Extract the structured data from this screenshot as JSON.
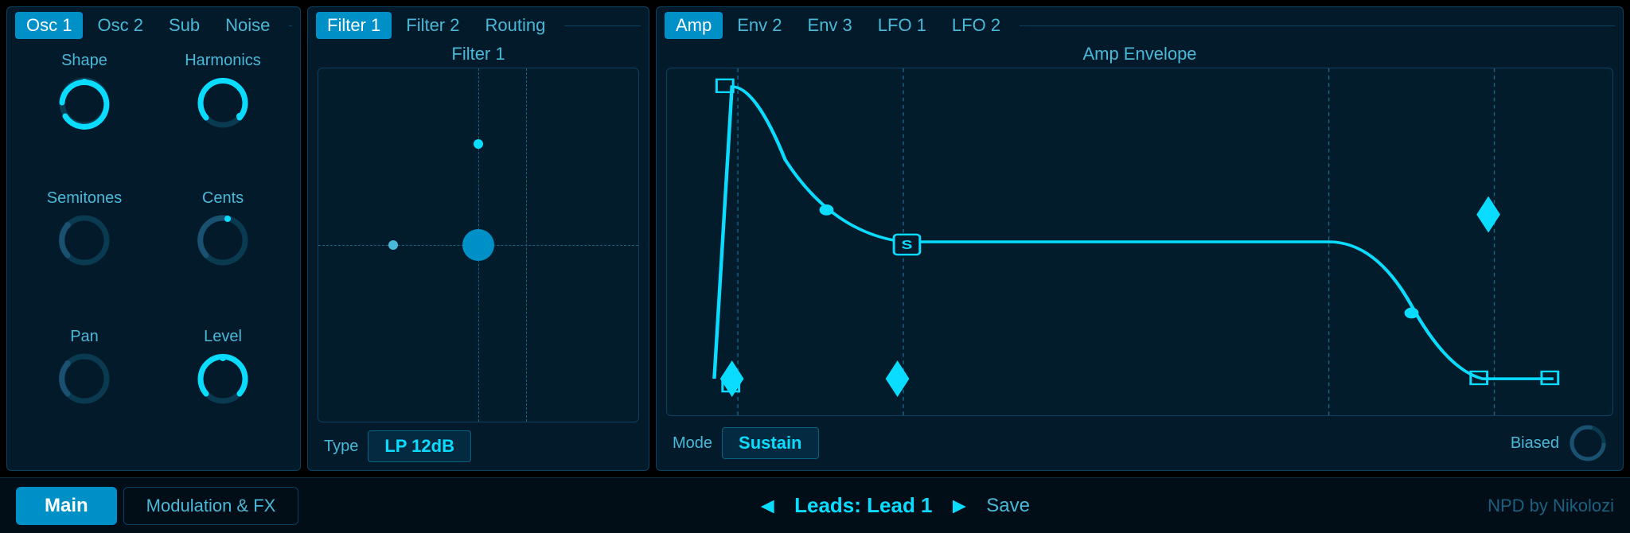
{
  "osc": {
    "tabs": [
      {
        "label": "Osc 1",
        "active": true
      },
      {
        "label": "Osc 2",
        "active": false
      },
      {
        "label": "Sub",
        "active": false
      },
      {
        "label": "Noise",
        "active": false
      }
    ],
    "knobs": [
      {
        "label": "Shape",
        "name": "shape-knob",
        "angle": 270,
        "color": "#0adcff",
        "filled": true
      },
      {
        "label": "Harmonics",
        "name": "harmonics-knob",
        "angle": 300,
        "color": "#0adcff",
        "filled": false
      },
      {
        "label": "Semitones",
        "name": "semitones-knob",
        "angle": 270,
        "color": "#1a5070",
        "filled": false
      },
      {
        "label": "Cents",
        "name": "cents-knob",
        "angle": 280,
        "color": "#1a5070",
        "filled": false
      },
      {
        "label": "Pan",
        "name": "pan-knob",
        "angle": 270,
        "color": "#1a5070",
        "filled": false
      },
      {
        "label": "Level",
        "name": "level-knob",
        "angle": 270,
        "color": "#0adcff",
        "filled": true
      }
    ]
  },
  "filter": {
    "tabs": [
      {
        "label": "Filter 1",
        "active": true
      },
      {
        "label": "Filter 2",
        "active": false
      },
      {
        "label": "Routing",
        "active": false
      }
    ],
    "title": "Filter 1",
    "type_label": "Type",
    "type_value": "LP 12dB"
  },
  "amp": {
    "tabs": [
      {
        "label": "Amp",
        "active": true
      },
      {
        "label": "Env 2",
        "active": false
      },
      {
        "label": "Env 3",
        "active": false
      },
      {
        "label": "LFO 1",
        "active": false
      },
      {
        "label": "LFO 2",
        "active": false
      }
    ],
    "title": "Amp Envelope",
    "mode_label": "Mode",
    "mode_value": "Sustain",
    "biased_label": "Biased"
  },
  "bottombar": {
    "main_label": "Main",
    "mod_label": "Modulation & FX",
    "prev_arrow": "◄",
    "next_arrow": "►",
    "preset_name": "Leads: Lead 1",
    "save_label": "Save",
    "credit": "NPD by Nikolozi"
  }
}
